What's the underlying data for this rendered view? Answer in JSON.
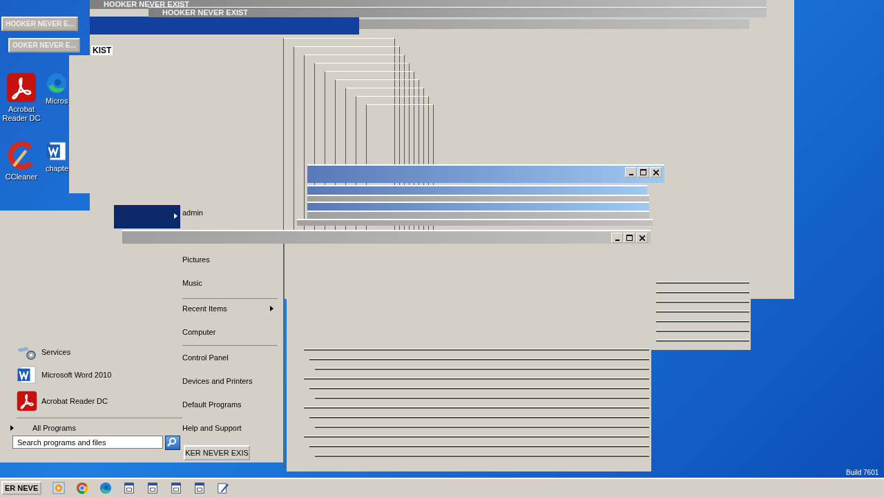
{
  "desktop_icons": [
    {
      "label": "Acrobat Reader DC",
      "kind": "acrobat"
    },
    {
      "label": "Micros",
      "kind": "edge"
    },
    {
      "label": "CCleaner",
      "kind": "ccleaner"
    },
    {
      "label": "chapte",
      "kind": "word"
    }
  ],
  "floating_buttons": [
    "HOOKER NEVER E...",
    "OOKER NEVER E..."
  ],
  "window_titles": [
    "HOOKER NEVER EXIST",
    "HOOKER NEVER EXIST"
  ],
  "fragment": "KIST",
  "start_menu": {
    "programs": [
      {
        "label": "Services",
        "kind": "services"
      },
      {
        "label": "Microsoft Word 2010",
        "kind": "word"
      },
      {
        "label": "Acrobat Reader DC",
        "kind": "acrobat"
      }
    ],
    "all_programs": "All Programs",
    "search": {
      "placeholder": "Search programs and files"
    },
    "user": "admin",
    "places": [
      {
        "label": "Pictures",
        "submenu": false
      },
      {
        "label": "Music",
        "submenu": false
      },
      {
        "label": "Recent Items",
        "submenu": true
      },
      {
        "label": "Computer",
        "submenu": false
      },
      {
        "label": "Control Panel",
        "submenu": false
      },
      {
        "label": "Devices and Printers",
        "submenu": false
      },
      {
        "label": "Default Programs",
        "submenu": false
      },
      {
        "label": "Help and Support",
        "submenu": false
      }
    ],
    "shutdown": "KER NEVER EXIS"
  },
  "taskbar": {
    "button": "ER NEVE",
    "icons": [
      {
        "kind": "media"
      },
      {
        "kind": "chrome"
      },
      {
        "kind": "edge"
      },
      {
        "kind": "app"
      },
      {
        "kind": "app"
      },
      {
        "kind": "app"
      },
      {
        "kind": "app"
      },
      {
        "kind": "notepad"
      }
    ]
  },
  "build": "Build 7601"
}
